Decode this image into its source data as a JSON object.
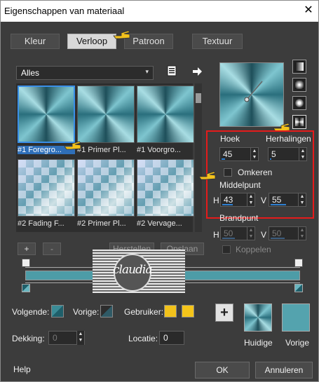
{
  "window": {
    "title": "Eigenschappen van materiaal",
    "close_glyph": "✕"
  },
  "tabs": [
    {
      "label": "Kleur",
      "active": false
    },
    {
      "label": "Verloop",
      "active": true
    },
    {
      "label": "Patroon",
      "active": false
    },
    {
      "label": "Textuur",
      "active": false
    }
  ],
  "category": {
    "value": "Alles",
    "arrow": "▾"
  },
  "gallery": [
    {
      "label": "#1 Foregro...",
      "style": "conic",
      "selected": true
    },
    {
      "label": "#1 Primer Pl...",
      "style": "conic",
      "selected": false
    },
    {
      "label": "#1 Voorgro...",
      "style": "conic",
      "selected": false
    },
    {
      "label": "#2 Fading F...",
      "style": "fade",
      "selected": false
    },
    {
      "label": "#2 Primer Pl...",
      "style": "fade",
      "selected": false
    },
    {
      "label": "#2 Vervage...",
      "style": "fade",
      "selected": false
    }
  ],
  "buttons": {
    "add": "+",
    "remove": "-",
    "herstellen": "Herstellen",
    "opslaan": "Opslaan"
  },
  "angle": {
    "label": "Hoek",
    "value": "45",
    "progress": 0.12
  },
  "repeats": {
    "label": "Herhalingen",
    "value": "5",
    "progress": 0.05
  },
  "invert": {
    "label": "Omkeren",
    "checked": false
  },
  "center": {
    "label": "Middelpunt",
    "h_label": "H",
    "h_value": "43",
    "h_progress": 0.43,
    "v_label": "V",
    "v_value": "55",
    "v_progress": 0.55
  },
  "focal": {
    "label": "Brandpunt",
    "h_label": "H",
    "h_value": "50",
    "h_progress": 0.5,
    "v_label": "V",
    "v_value": "50",
    "v_progress": 0.5,
    "link_label": "Koppelen",
    "link_checked": false
  },
  "watermark": {
    "text": "claudia"
  },
  "stops": {
    "volgende_label": "Volgende:",
    "vorige_label": "Vorige:",
    "gebruiker_label": "Gebruiker:",
    "user_color_1": "#f2c21b",
    "user_color_2": "#f5c51a"
  },
  "opacity": {
    "label": "Dekking:",
    "value": "0"
  },
  "location": {
    "label": "Locatie:",
    "value": "0"
  },
  "current": {
    "label": "Huidige"
  },
  "previous": {
    "label": "Vorige",
    "color": "#54a3ae"
  },
  "footer": {
    "help": "Help",
    "ok": "OK",
    "cancel": "Annuleren"
  },
  "colors": {
    "selection": "#3a8fe8",
    "highlight_box": "#e51b1b",
    "pointer_hand": "#f3c21c"
  }
}
